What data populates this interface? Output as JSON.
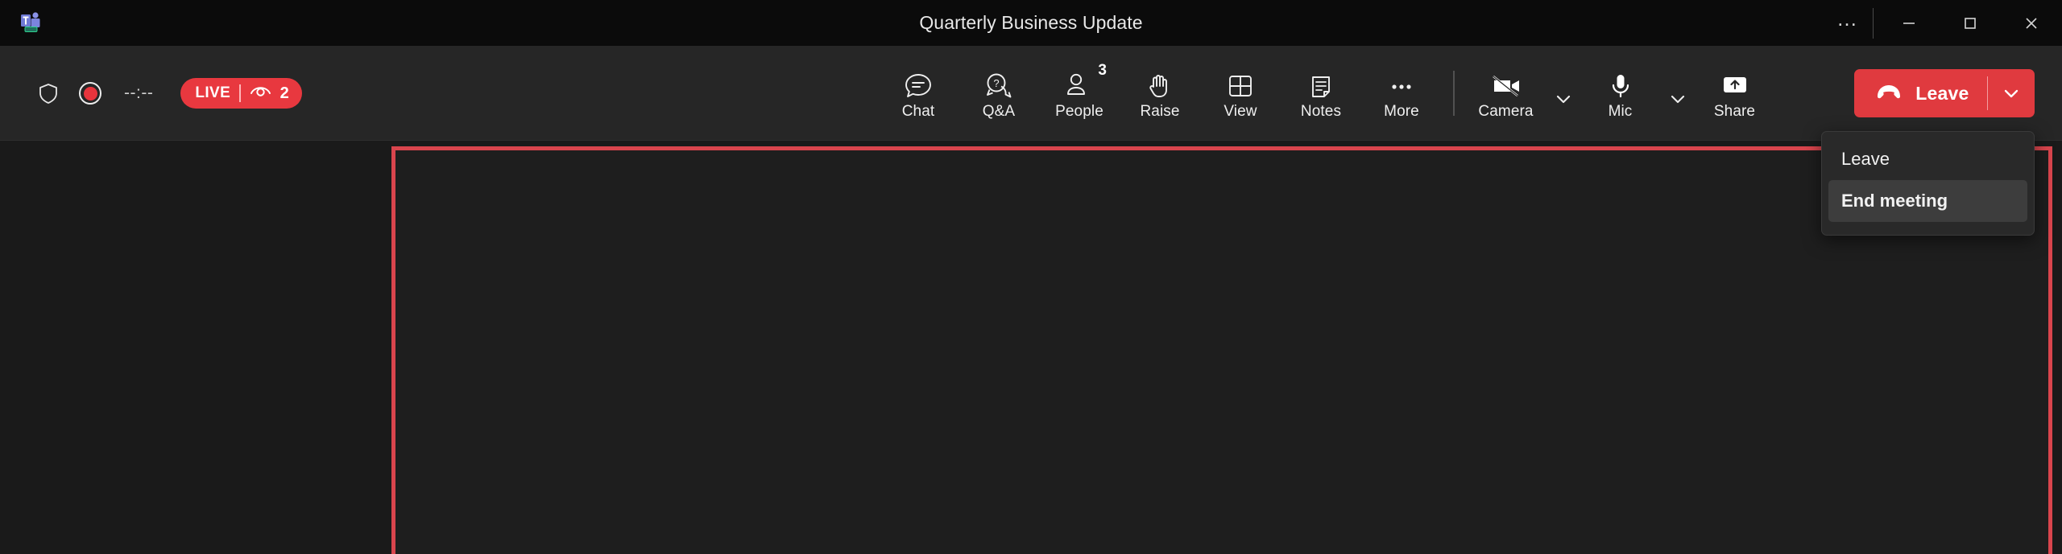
{
  "window": {
    "title": "Quarterly Business Update",
    "logo_icon": "teams-logo-icon",
    "more_label": "…",
    "minimize_label": "minimize",
    "maximize_label": "maximize",
    "close_label": "close"
  },
  "toolbar": {
    "shield_icon": "shield-icon",
    "record_icon": "record-indicator-icon",
    "timer": "--:--",
    "live": {
      "label": "LIVE",
      "viewers_icon": "eye-icon",
      "viewers": "2",
      "color": "#e8383f"
    },
    "items": [
      {
        "label": "Chat",
        "icon": "chat-icon",
        "badge": ""
      },
      {
        "label": "Q&A",
        "icon": "qa-icon",
        "badge": ""
      },
      {
        "label": "People",
        "icon": "people-icon",
        "badge": "3"
      },
      {
        "label": "Raise",
        "icon": "raise-hand-icon",
        "badge": ""
      },
      {
        "label": "View",
        "icon": "view-grid-icon",
        "badge": ""
      },
      {
        "label": "Notes",
        "icon": "notes-icon",
        "badge": ""
      },
      {
        "label": "More",
        "icon": "more-dots-icon",
        "badge": ""
      }
    ],
    "devices": [
      {
        "label": "Camera",
        "icon": "camera-off-icon",
        "chevron": "chevron-down-icon"
      },
      {
        "label": "Mic",
        "icon": "mic-icon",
        "chevron": "chevron-down-icon"
      },
      {
        "label": "Share",
        "icon": "share-screen-icon",
        "chevron": ""
      }
    ],
    "leave": {
      "label": "Leave",
      "icon": "hangup-icon",
      "chevron": "chevron-down-icon",
      "color": "#e03a3f"
    }
  },
  "leave_menu": {
    "items": [
      {
        "label": "Leave",
        "active": false
      },
      {
        "label": "End meeting",
        "active": true
      }
    ]
  },
  "content": {
    "share_border_color": "#d9454d"
  }
}
